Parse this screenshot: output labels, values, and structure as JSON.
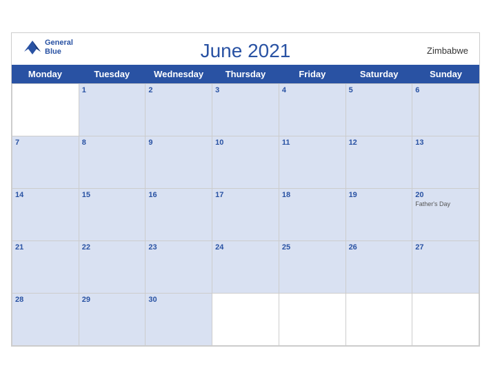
{
  "header": {
    "title": "June 2021",
    "country": "Zimbabwe",
    "logo_line1": "General",
    "logo_line2": "Blue"
  },
  "days": [
    "Monday",
    "Tuesday",
    "Wednesday",
    "Thursday",
    "Friday",
    "Saturday",
    "Sunday"
  ],
  "weeks": [
    [
      {
        "date": "",
        "empty": true
      },
      {
        "date": "1"
      },
      {
        "date": "2"
      },
      {
        "date": "3"
      },
      {
        "date": "4"
      },
      {
        "date": "5"
      },
      {
        "date": "6"
      }
    ],
    [
      {
        "date": "7"
      },
      {
        "date": "8"
      },
      {
        "date": "9"
      },
      {
        "date": "10"
      },
      {
        "date": "11"
      },
      {
        "date": "12"
      },
      {
        "date": "13"
      }
    ],
    [
      {
        "date": "14"
      },
      {
        "date": "15"
      },
      {
        "date": "16"
      },
      {
        "date": "17"
      },
      {
        "date": "18"
      },
      {
        "date": "19"
      },
      {
        "date": "20",
        "event": "Father's Day"
      }
    ],
    [
      {
        "date": "21"
      },
      {
        "date": "22"
      },
      {
        "date": "23"
      },
      {
        "date": "24"
      },
      {
        "date": "25"
      },
      {
        "date": "26"
      },
      {
        "date": "27"
      }
    ],
    [
      {
        "date": "28"
      },
      {
        "date": "29"
      },
      {
        "date": "30"
      },
      {
        "date": "",
        "empty": true
      },
      {
        "date": "",
        "empty": true
      },
      {
        "date": "",
        "empty": true
      },
      {
        "date": "",
        "empty": true
      }
    ]
  ]
}
